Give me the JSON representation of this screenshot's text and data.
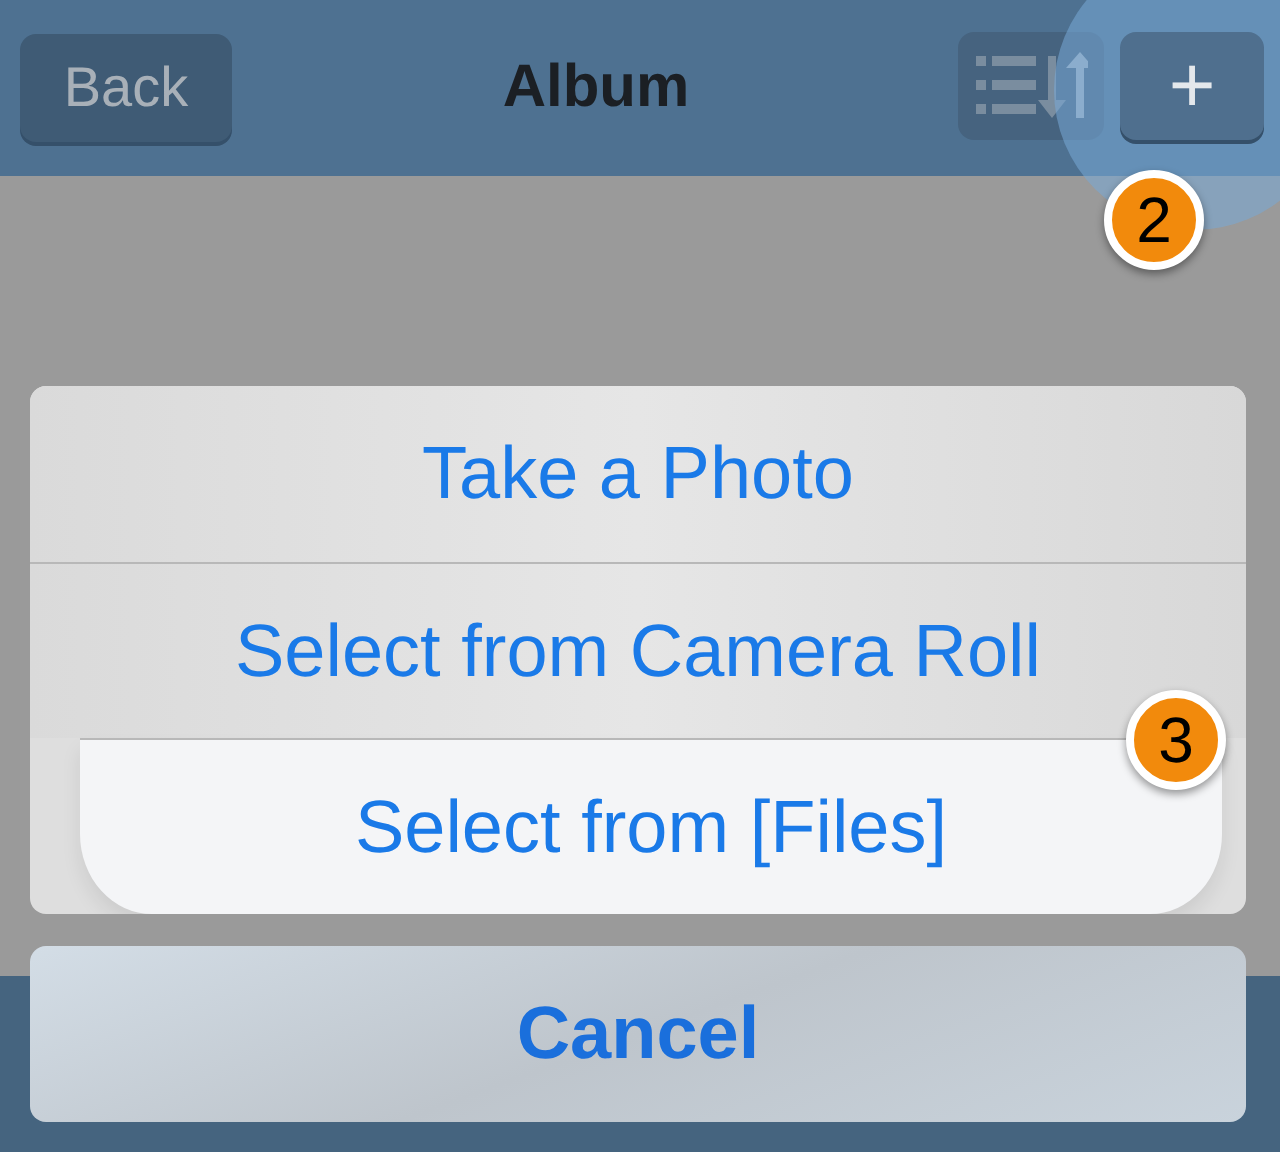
{
  "nav_bar": {
    "back_button": "Back",
    "title": "Album",
    "add_button": "+",
    "add_highlighted": true
  },
  "action_sheet": {
    "options": [
      {
        "label": "Take a Photo",
        "selected": false
      },
      {
        "label": "Select from Camera Roll",
        "selected": false
      },
      {
        "label": "Select from [Files]",
        "selected": true
      }
    ],
    "cancel": "Cancel"
  },
  "callouts": [
    "2",
    "3"
  ]
}
